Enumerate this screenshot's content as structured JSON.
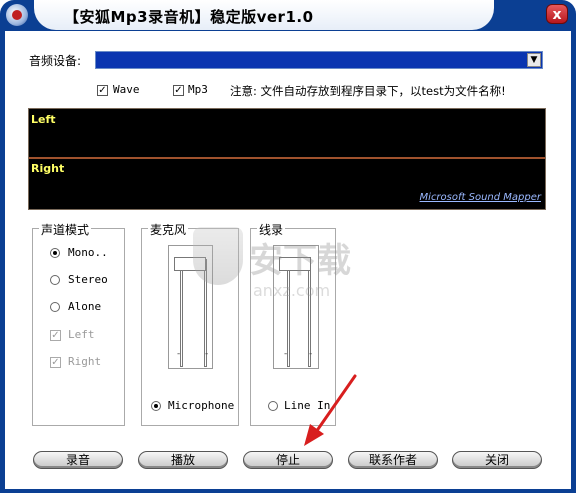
{
  "window": {
    "title": "【安狐Mp3录音机】稳定版ver1.0",
    "close_glyph": "x"
  },
  "device": {
    "label": "音频设备:",
    "selected": ""
  },
  "options": {
    "wave_label": "Wave",
    "wave_checked": true,
    "mp3_label": "Mp3",
    "mp3_checked": true,
    "note": "注意: 文件自动存放到程序目录下，以test为文件名称!"
  },
  "meters": {
    "left_label": "Left",
    "right_label": "Right",
    "mapper_link": "Microsoft Sound Mapper"
  },
  "channel_mode": {
    "title": "声道模式",
    "options": [
      {
        "label": "Mono..",
        "selected": true
      },
      {
        "label": "Stereo",
        "selected": false
      },
      {
        "label": "Alone",
        "selected": false
      }
    ],
    "left_label": "Left",
    "right_label": "Right"
  },
  "microphone": {
    "title": "麦克风",
    "radio_label": "Microphone",
    "selected": true
  },
  "linein": {
    "title": "线录",
    "radio_label": "Line In",
    "selected": false
  },
  "buttons": {
    "record": "录音",
    "play": "播放",
    "stop": "停止",
    "contact": "联系作者",
    "close": "关闭"
  },
  "watermark": {
    "main": "安下载",
    "sub": "anxz.com"
  },
  "colors": {
    "frame": "#0b3f93",
    "meter_bg": "#000000",
    "meter_label": "#ffff66",
    "select_bg": "#0a35b0",
    "arrow": "#d81e1e"
  }
}
